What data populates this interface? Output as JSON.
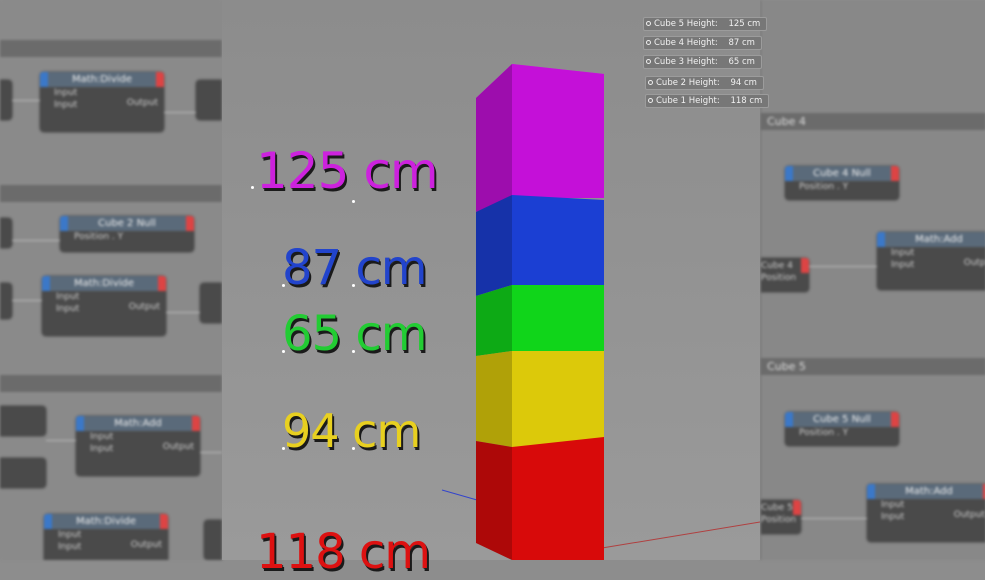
{
  "readouts": [
    {
      "label": "Cube 5 Height:",
      "value": "125 cm"
    },
    {
      "label": "Cube 4 Height:",
      "value": "87 cm"
    },
    {
      "label": "Cube 3 Height:",
      "value": "65 cm"
    },
    {
      "label": "Cube 2 Height:",
      "value": "94 cm"
    },
    {
      "label": "Cube 1 Height:",
      "value": "118 cm"
    }
  ],
  "labels3d": [
    {
      "text": "125 cm",
      "color": "#cc22dd"
    },
    {
      "text": "87 cm",
      "color": "#2244cc"
    },
    {
      "text": "65 cm",
      "color": "#22cc33"
    },
    {
      "text": "94 cm",
      "color": "#e8d020"
    },
    {
      "text": "118 cm",
      "color": "#dd1111"
    }
  ],
  "cube_colors": {
    "cube5": "#c410d8",
    "cube4": "#1b3fd3",
    "cube3": "#10d51a",
    "cube2": "#dcc90a",
    "cube1": "#d80a0a"
  },
  "left_nodes": {
    "divide1": {
      "title": "Math:Divide",
      "in1": "Input",
      "in2": "Input",
      "out": "Output"
    },
    "cube2null": {
      "title": "Cube 2 Null",
      "row": "Position . Y"
    },
    "divide2": {
      "title": "Math:Divide",
      "in1": "Input",
      "in2": "Input",
      "out": "Output"
    },
    "add1": {
      "title": "Math:Add",
      "in1": "Input",
      "in2": "Input",
      "out": "Output"
    },
    "divide3": {
      "title": "Math:Divide",
      "in1": "Input",
      "in2": "Input",
      "out": "Output"
    }
  },
  "right_panel": {
    "group4": "Cube 4",
    "cube4null": {
      "title": "Cube 4 Null",
      "row": "Position . Y"
    },
    "add4": {
      "title": "Math:Add",
      "in1": "Input",
      "in2": "Input",
      "out": "Output"
    },
    "cube4ref": "Cube 4",
    "position_ref": "Position",
    "group5": "Cube 5",
    "cube5null": {
      "title": "Cube 5 Null",
      "row": "Position . Y"
    },
    "add5": {
      "title": "Math:Add",
      "in1": "Input",
      "in2": "Input",
      "out": "Output"
    },
    "cube5ref": "Cube 5",
    "position_ref2": "Position"
  }
}
